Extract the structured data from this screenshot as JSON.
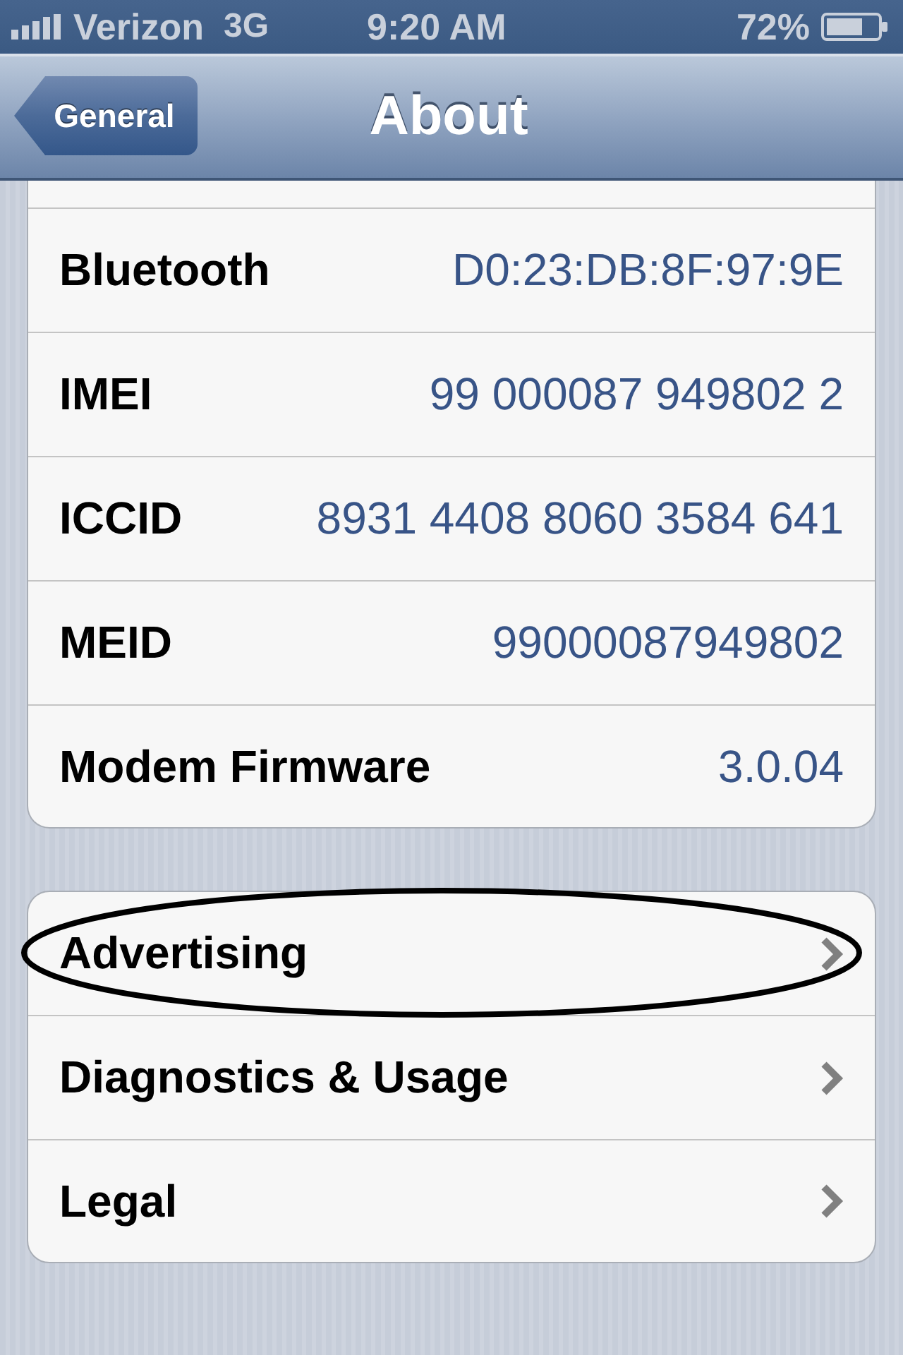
{
  "status_bar": {
    "carrier": "Verizon",
    "network": "3G",
    "time": "9:20 AM",
    "battery": "72%"
  },
  "nav_bar": {
    "back_button": "General",
    "title": "About"
  },
  "groups": [
    {
      "clipped_top": true,
      "rows": [
        {
          "kind": "info",
          "label": "Bluetooth",
          "value": "D0:23:DB:8F:97:9E",
          "circled": false
        },
        {
          "kind": "info",
          "label": "IMEI",
          "value": "99 000087 949802 2",
          "circled": false
        },
        {
          "kind": "info",
          "label": "ICCID",
          "value": "8931 4408 8060 3584 641",
          "circled": false
        },
        {
          "kind": "info",
          "label": "MEID",
          "value": "99000087949802",
          "circled": false
        },
        {
          "kind": "info",
          "label": "Modem Firmware",
          "value": "3.0.04",
          "circled": false
        }
      ]
    },
    {
      "clipped_top": false,
      "rows": [
        {
          "kind": "link",
          "label": "Advertising",
          "circled": true
        },
        {
          "kind": "link",
          "label": "Diagnostics & Usage",
          "circled": false
        },
        {
          "kind": "link",
          "label": "Legal",
          "circled": false
        }
      ]
    }
  ]
}
